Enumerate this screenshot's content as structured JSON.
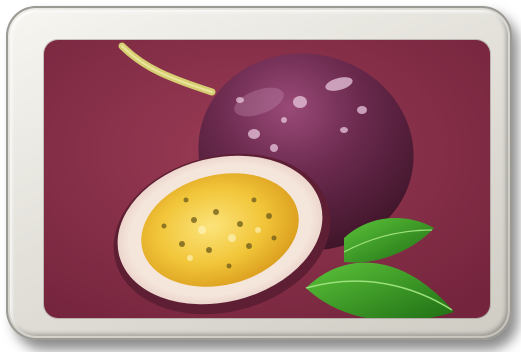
{
  "image": {
    "subject": "",
    "colors": {
      "frame": "#e6e4de",
      "background": "#8a2f48",
      "fruit_skin": "#5e2340",
      "pulp": "#f2c63a",
      "leaf": "#2f8f1f",
      "stem": "#d8d070"
    }
  }
}
